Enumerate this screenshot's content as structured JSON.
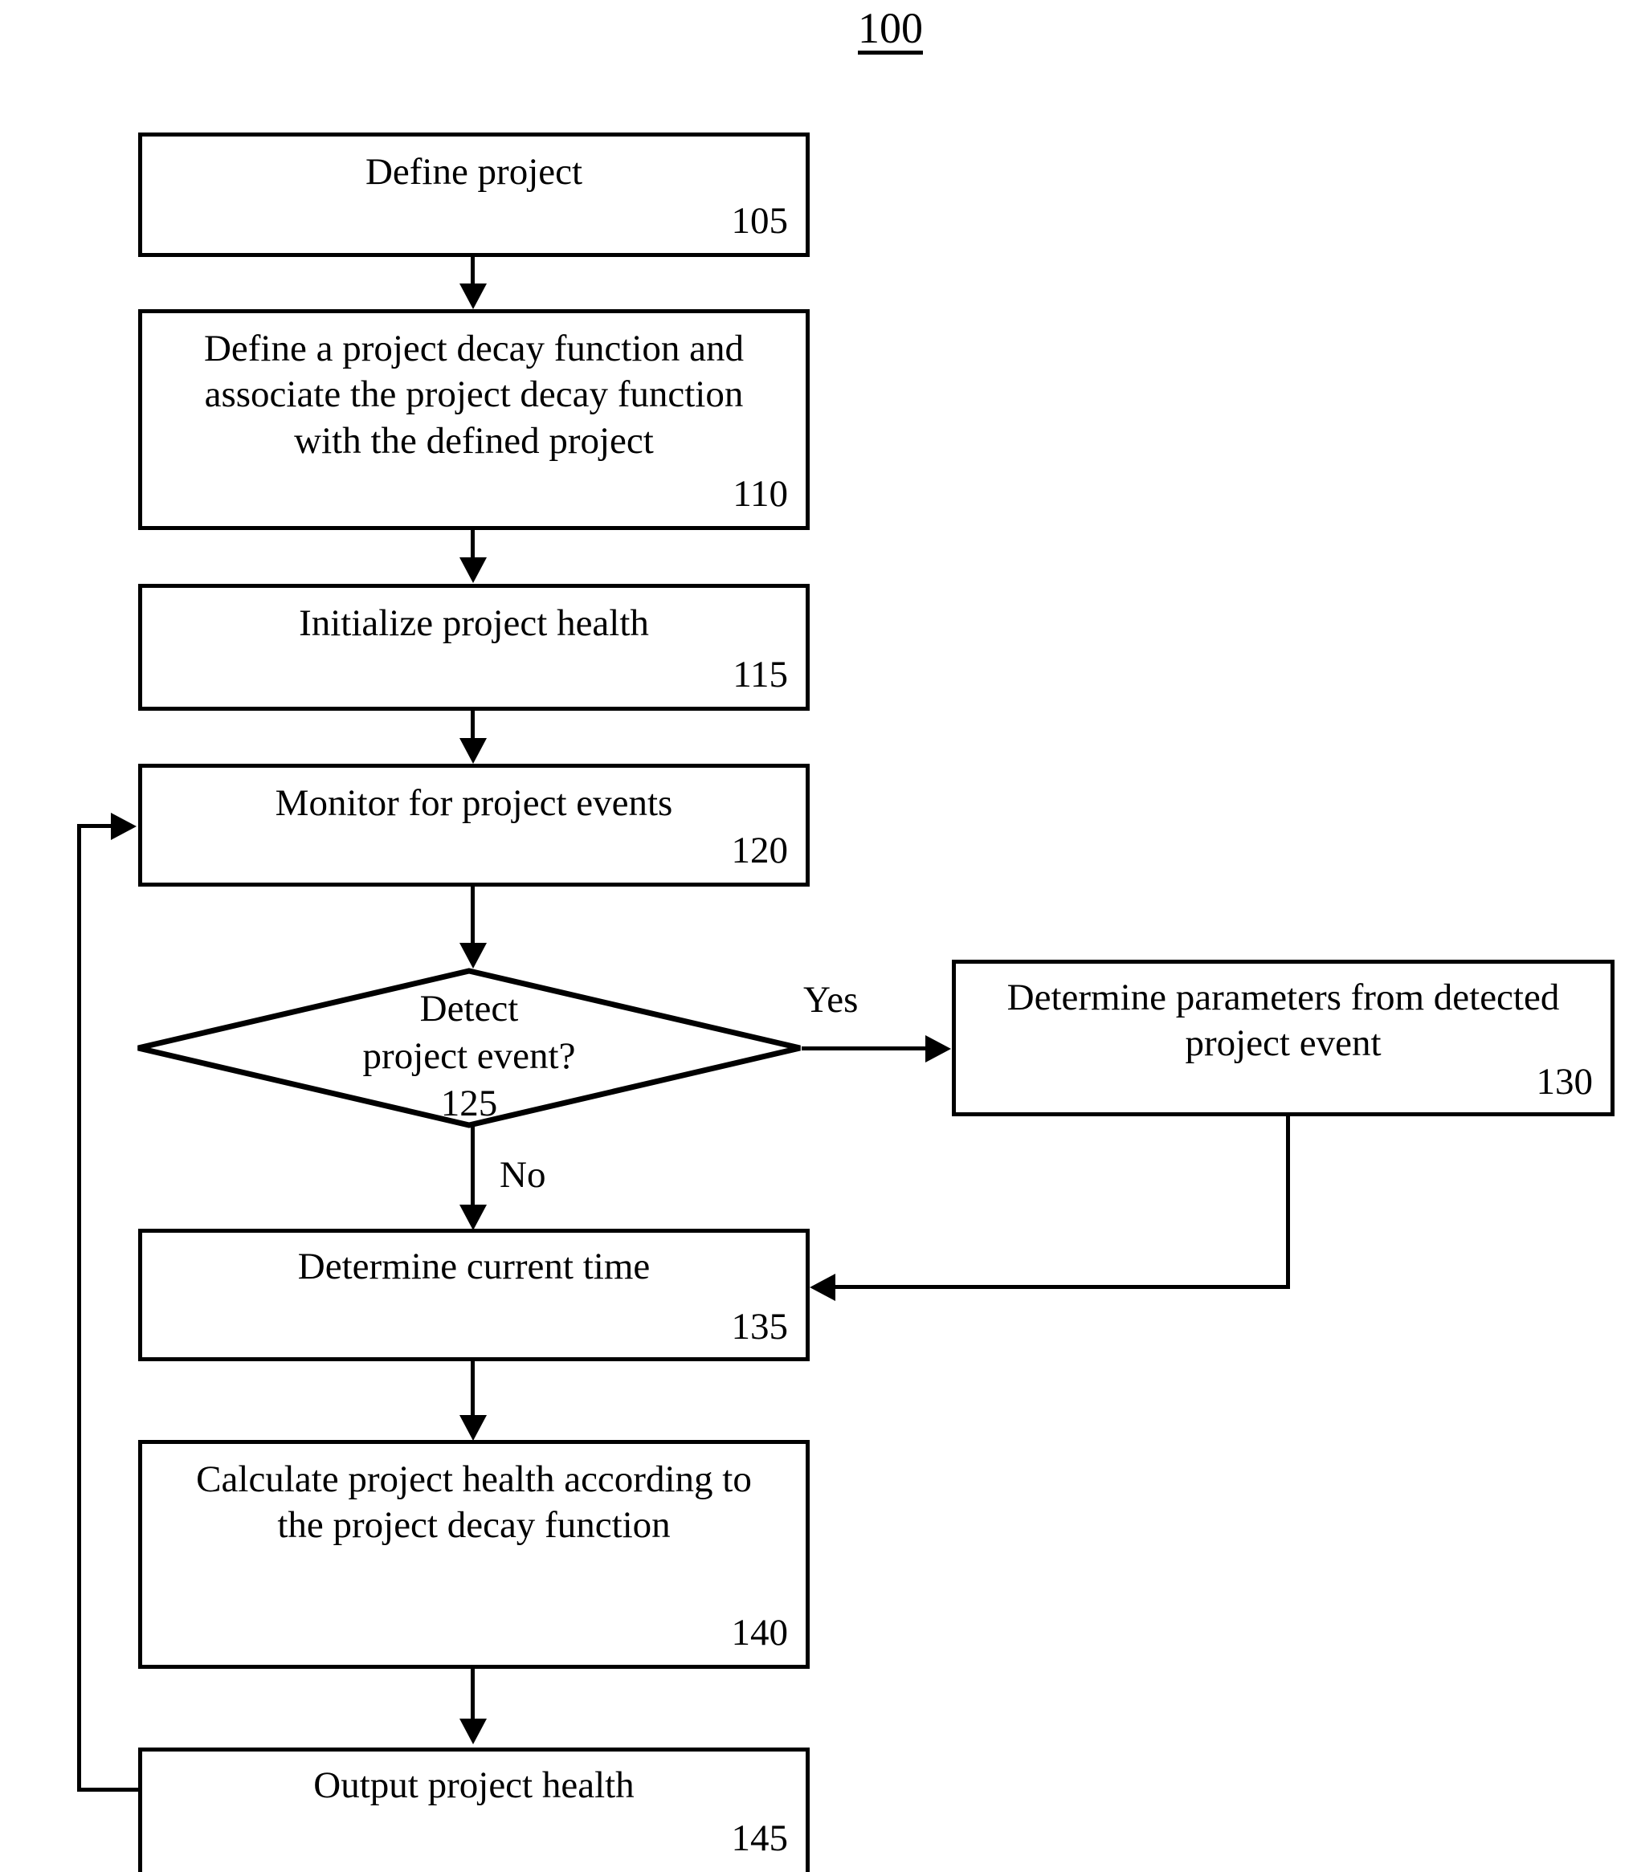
{
  "figure": {
    "number": "100"
  },
  "nodes": [
    {
      "id": "105",
      "shape": "process",
      "label": "Define project",
      "ref": "105"
    },
    {
      "id": "110",
      "shape": "process",
      "label": "Define a project decay function and\nassociate the project decay function\nwith the defined project",
      "ref": "110"
    },
    {
      "id": "115",
      "shape": "process",
      "label": "Initialize project health",
      "ref": "115"
    },
    {
      "id": "120",
      "shape": "process",
      "label": "Monitor for project events",
      "ref": "120"
    },
    {
      "id": "125",
      "shape": "decision",
      "label": "Detect\nproject event?\n125",
      "ref": "125"
    },
    {
      "id": "130",
      "shape": "process",
      "label": "Determine parameters from detected\nproject event",
      "ref": "130"
    },
    {
      "id": "135",
      "shape": "process",
      "label": "Determine current time",
      "ref": "135"
    },
    {
      "id": "140",
      "shape": "process",
      "label": "Calculate project health according to\nthe project decay function",
      "ref": "140"
    },
    {
      "id": "145",
      "shape": "process",
      "label": "Output project health",
      "ref": "145"
    }
  ],
  "branch_labels": {
    "yes": "Yes",
    "no": "No"
  },
  "colors": {
    "stroke": "#000000",
    "background": "#ffffff"
  }
}
